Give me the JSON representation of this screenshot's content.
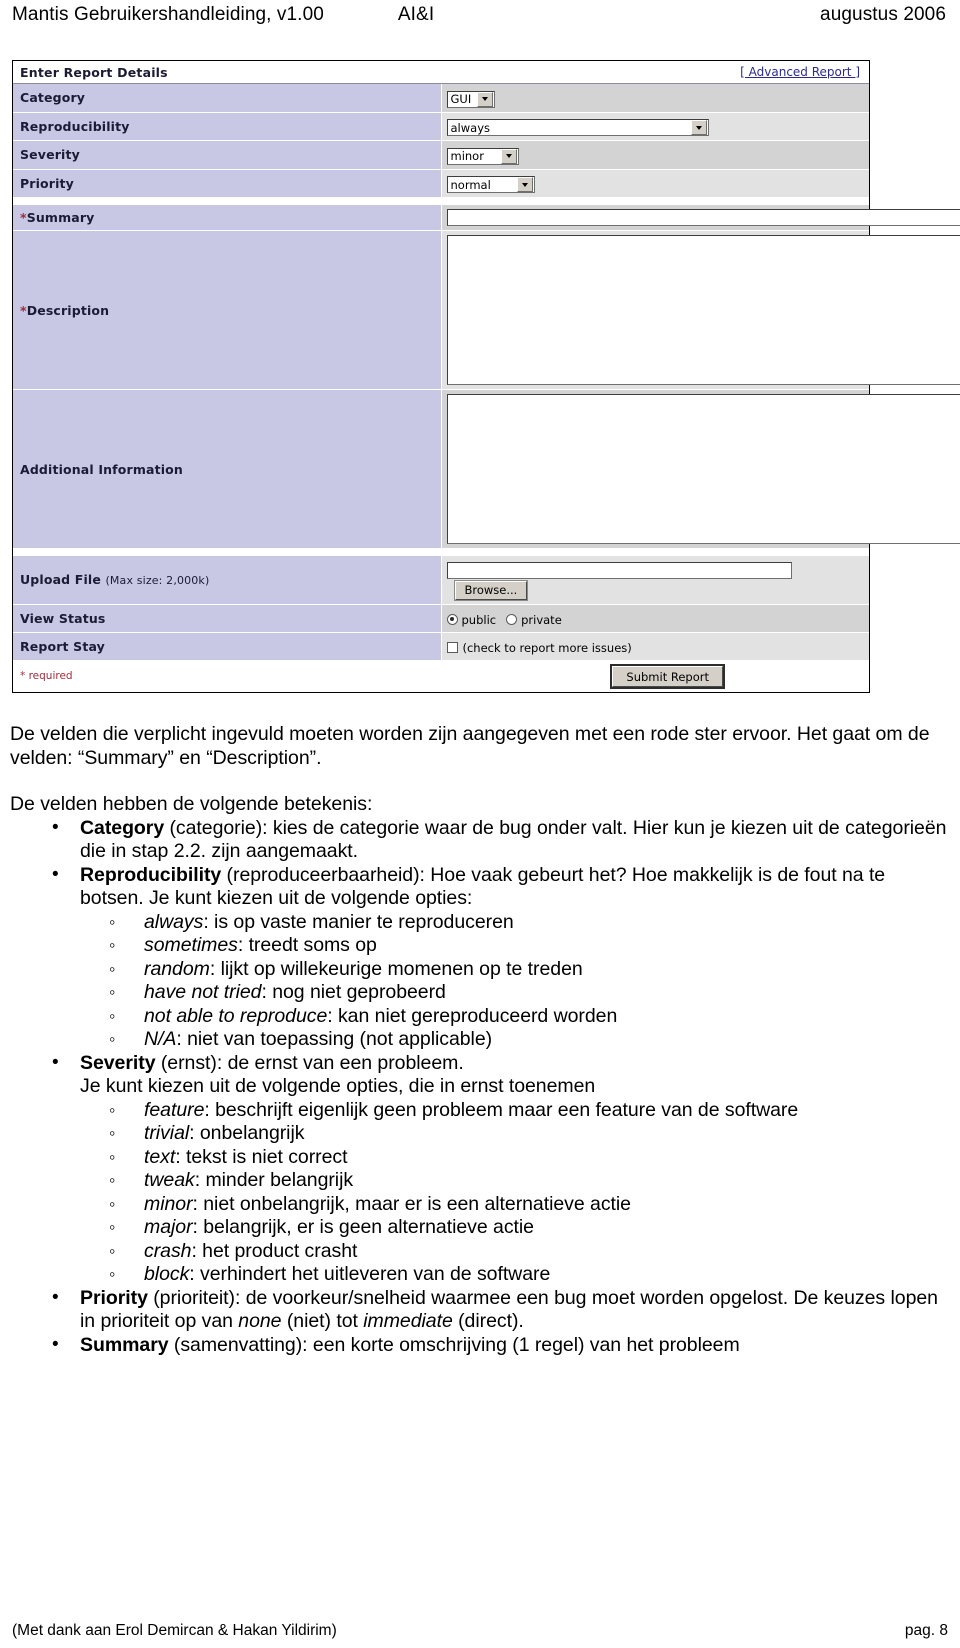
{
  "header": {
    "left": "Mantis Gebruikershandleiding, v1.00",
    "middle": "AI&I",
    "right": "augustus 2006"
  },
  "screenshot": {
    "title": "Enter Report Details",
    "advanced_link": "[ Advanced Report ]",
    "rows": {
      "category": {
        "label": "Category",
        "value": "GUI"
      },
      "reproducibility": {
        "label": "Reproducibility",
        "value": "always"
      },
      "severity": {
        "label": "Severity",
        "value": "minor"
      },
      "priority": {
        "label": "Priority",
        "value": "normal"
      },
      "summary": {
        "label": "Summary",
        "required_mark": "*",
        "value": ""
      },
      "description": {
        "label": "Description",
        "required_mark": "*",
        "value": ""
      },
      "additional_information": {
        "label": "Additional Information",
        "value": ""
      },
      "upload_file": {
        "label": "Upload File",
        "hint": "(Max size: 2,000k)",
        "value": "",
        "browse_label": "Browse..."
      },
      "view_status": {
        "label": "View Status",
        "public_label": "public",
        "private_label": "private",
        "selected": "public"
      },
      "report_stay": {
        "label": "Report Stay",
        "hint": "(check to report more issues)",
        "checked": false
      }
    },
    "footer": {
      "required_note": "* required",
      "submit_label": "Submit Report"
    }
  },
  "body": {
    "intro": "De velden die verplicht ingevuld moeten worden zijn aangegeven met een rode ster ervoor. Het gaat om de velden: “Summary”  en “Description”.",
    "lead": "De velden hebben de volgende betekenis:",
    "bullets": [
      {
        "term": "Category",
        "rest": " (categorie): kies de categorie waar de bug onder valt. Hier kun je kiezen uit de categorieën die in stap 2.2. zijn aangemaakt."
      },
      {
        "term": "Reproducibility",
        "rest": " (reproduceerbaarheid): Hoe vaak gebeurt het? Hoe makkelijk is de fout na te botsen. Je kunt kiezen uit de volgende opties:",
        "options": [
          {
            "name": "always",
            "desc": ": is op vaste manier te reproduceren"
          },
          {
            "name": "sometimes",
            "desc": ": treedt soms op"
          },
          {
            "name": "random",
            "desc": ": lijkt op willekeurige momenen op te treden"
          },
          {
            "name": "have not tried",
            "desc": ": nog niet geprobeerd"
          },
          {
            "name": "not able to reproduce",
            "desc": ": kan niet gereproduceerd worden"
          },
          {
            "name": "N/A",
            "desc": ": niet van toepassing (not applicable)"
          }
        ]
      },
      {
        "term": "Severity",
        "rest": " (ernst): de ernst van een probleem.",
        "rest2": "Je kunt kiezen uit de volgende opties, die in ernst toenemen",
        "options": [
          {
            "name": "feature",
            "desc": ": beschrijft eigenlijk geen probleem maar een feature van de software"
          },
          {
            "name": "trivial",
            "desc": ": onbelangrijk"
          },
          {
            "name": "text",
            "desc": ": tekst is niet correct"
          },
          {
            "name": "tweak",
            "desc": ": minder belangrijk"
          },
          {
            "name": "minor",
            "desc": ": niet onbelangrijk, maar er is een alternatieve actie"
          },
          {
            "name": "major",
            "desc": ": belangrijk, er is geen alternatieve actie"
          },
          {
            "name": "crash",
            "desc": ": het product crasht"
          },
          {
            "name": "block",
            "desc": ": verhindert het uitleveren van de software"
          }
        ]
      },
      {
        "term": "Priority",
        "rest_a": " (prioriteit): de voorkeur/snelheid waarmee een bug moet worden opgelost. De keuzes lopen in prioriteit op van ",
        "em_a": "none",
        "rest_b": " (niet) tot ",
        "em_b": "immediate",
        "rest_c": " (direct)."
      },
      {
        "term": "Summary",
        "rest": " (samenvatting): een korte omschrijving (1 regel) van het probleem"
      }
    ]
  },
  "footer": {
    "left": "(Met dank aan Erol Demircan & Hakan Yildirim)",
    "right": "pag. 8"
  }
}
